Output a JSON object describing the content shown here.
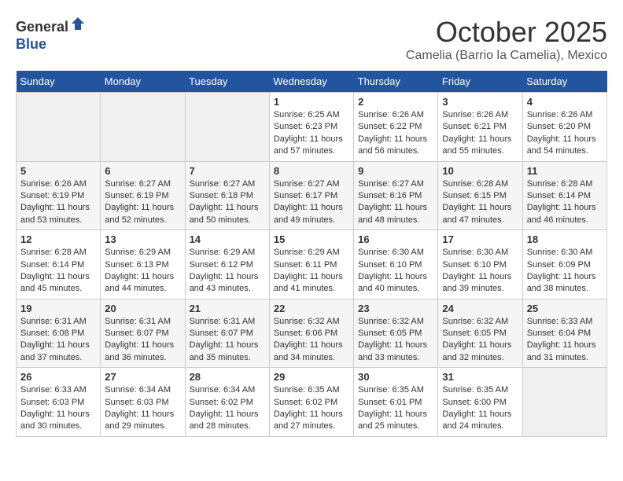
{
  "header": {
    "logo_line1": "General",
    "logo_line2": "Blue",
    "month_title": "October 2025",
    "location": "Camelia (Barrio la Camelia), Mexico"
  },
  "weekdays": [
    "Sunday",
    "Monday",
    "Tuesday",
    "Wednesday",
    "Thursday",
    "Friday",
    "Saturday"
  ],
  "weeks": [
    {
      "days": [
        {
          "num": "",
          "info": ""
        },
        {
          "num": "",
          "info": ""
        },
        {
          "num": "",
          "info": ""
        },
        {
          "num": "1",
          "info": "Sunrise: 6:25 AM\nSunset: 6:23 PM\nDaylight: 11 hours and 57 minutes."
        },
        {
          "num": "2",
          "info": "Sunrise: 6:26 AM\nSunset: 6:22 PM\nDaylight: 11 hours and 56 minutes."
        },
        {
          "num": "3",
          "info": "Sunrise: 6:26 AM\nSunset: 6:21 PM\nDaylight: 11 hours and 55 minutes."
        },
        {
          "num": "4",
          "info": "Sunrise: 6:26 AM\nSunset: 6:20 PM\nDaylight: 11 hours and 54 minutes."
        }
      ]
    },
    {
      "days": [
        {
          "num": "5",
          "info": "Sunrise: 6:26 AM\nSunset: 6:19 PM\nDaylight: 11 hours and 53 minutes."
        },
        {
          "num": "6",
          "info": "Sunrise: 6:27 AM\nSunset: 6:19 PM\nDaylight: 11 hours and 52 minutes."
        },
        {
          "num": "7",
          "info": "Sunrise: 6:27 AM\nSunset: 6:18 PM\nDaylight: 11 hours and 50 minutes."
        },
        {
          "num": "8",
          "info": "Sunrise: 6:27 AM\nSunset: 6:17 PM\nDaylight: 11 hours and 49 minutes."
        },
        {
          "num": "9",
          "info": "Sunrise: 6:27 AM\nSunset: 6:16 PM\nDaylight: 11 hours and 48 minutes."
        },
        {
          "num": "10",
          "info": "Sunrise: 6:28 AM\nSunset: 6:15 PM\nDaylight: 11 hours and 47 minutes."
        },
        {
          "num": "11",
          "info": "Sunrise: 6:28 AM\nSunset: 6:14 PM\nDaylight: 11 hours and 46 minutes."
        }
      ]
    },
    {
      "days": [
        {
          "num": "12",
          "info": "Sunrise: 6:28 AM\nSunset: 6:14 PM\nDaylight: 11 hours and 45 minutes."
        },
        {
          "num": "13",
          "info": "Sunrise: 6:29 AM\nSunset: 6:13 PM\nDaylight: 11 hours and 44 minutes."
        },
        {
          "num": "14",
          "info": "Sunrise: 6:29 AM\nSunset: 6:12 PM\nDaylight: 11 hours and 43 minutes."
        },
        {
          "num": "15",
          "info": "Sunrise: 6:29 AM\nSunset: 6:11 PM\nDaylight: 11 hours and 41 minutes."
        },
        {
          "num": "16",
          "info": "Sunrise: 6:30 AM\nSunset: 6:10 PM\nDaylight: 11 hours and 40 minutes."
        },
        {
          "num": "17",
          "info": "Sunrise: 6:30 AM\nSunset: 6:10 PM\nDaylight: 11 hours and 39 minutes."
        },
        {
          "num": "18",
          "info": "Sunrise: 6:30 AM\nSunset: 6:09 PM\nDaylight: 11 hours and 38 minutes."
        }
      ]
    },
    {
      "days": [
        {
          "num": "19",
          "info": "Sunrise: 6:31 AM\nSunset: 6:08 PM\nDaylight: 11 hours and 37 minutes."
        },
        {
          "num": "20",
          "info": "Sunrise: 6:31 AM\nSunset: 6:07 PM\nDaylight: 11 hours and 36 minutes."
        },
        {
          "num": "21",
          "info": "Sunrise: 6:31 AM\nSunset: 6:07 PM\nDaylight: 11 hours and 35 minutes."
        },
        {
          "num": "22",
          "info": "Sunrise: 6:32 AM\nSunset: 6:06 PM\nDaylight: 11 hours and 34 minutes."
        },
        {
          "num": "23",
          "info": "Sunrise: 6:32 AM\nSunset: 6:05 PM\nDaylight: 11 hours and 33 minutes."
        },
        {
          "num": "24",
          "info": "Sunrise: 6:32 AM\nSunset: 6:05 PM\nDaylight: 11 hours and 32 minutes."
        },
        {
          "num": "25",
          "info": "Sunrise: 6:33 AM\nSunset: 6:04 PM\nDaylight: 11 hours and 31 minutes."
        }
      ]
    },
    {
      "days": [
        {
          "num": "26",
          "info": "Sunrise: 6:33 AM\nSunset: 6:03 PM\nDaylight: 11 hours and 30 minutes."
        },
        {
          "num": "27",
          "info": "Sunrise: 6:34 AM\nSunset: 6:03 PM\nDaylight: 11 hours and 29 minutes."
        },
        {
          "num": "28",
          "info": "Sunrise: 6:34 AM\nSunset: 6:02 PM\nDaylight: 11 hours and 28 minutes."
        },
        {
          "num": "29",
          "info": "Sunrise: 6:35 AM\nSunset: 6:02 PM\nDaylight: 11 hours and 27 minutes."
        },
        {
          "num": "30",
          "info": "Sunrise: 6:35 AM\nSunset: 6:01 PM\nDaylight: 11 hours and 25 minutes."
        },
        {
          "num": "31",
          "info": "Sunrise: 6:35 AM\nSunset: 6:00 PM\nDaylight: 11 hours and 24 minutes."
        },
        {
          "num": "",
          "info": ""
        }
      ]
    }
  ]
}
